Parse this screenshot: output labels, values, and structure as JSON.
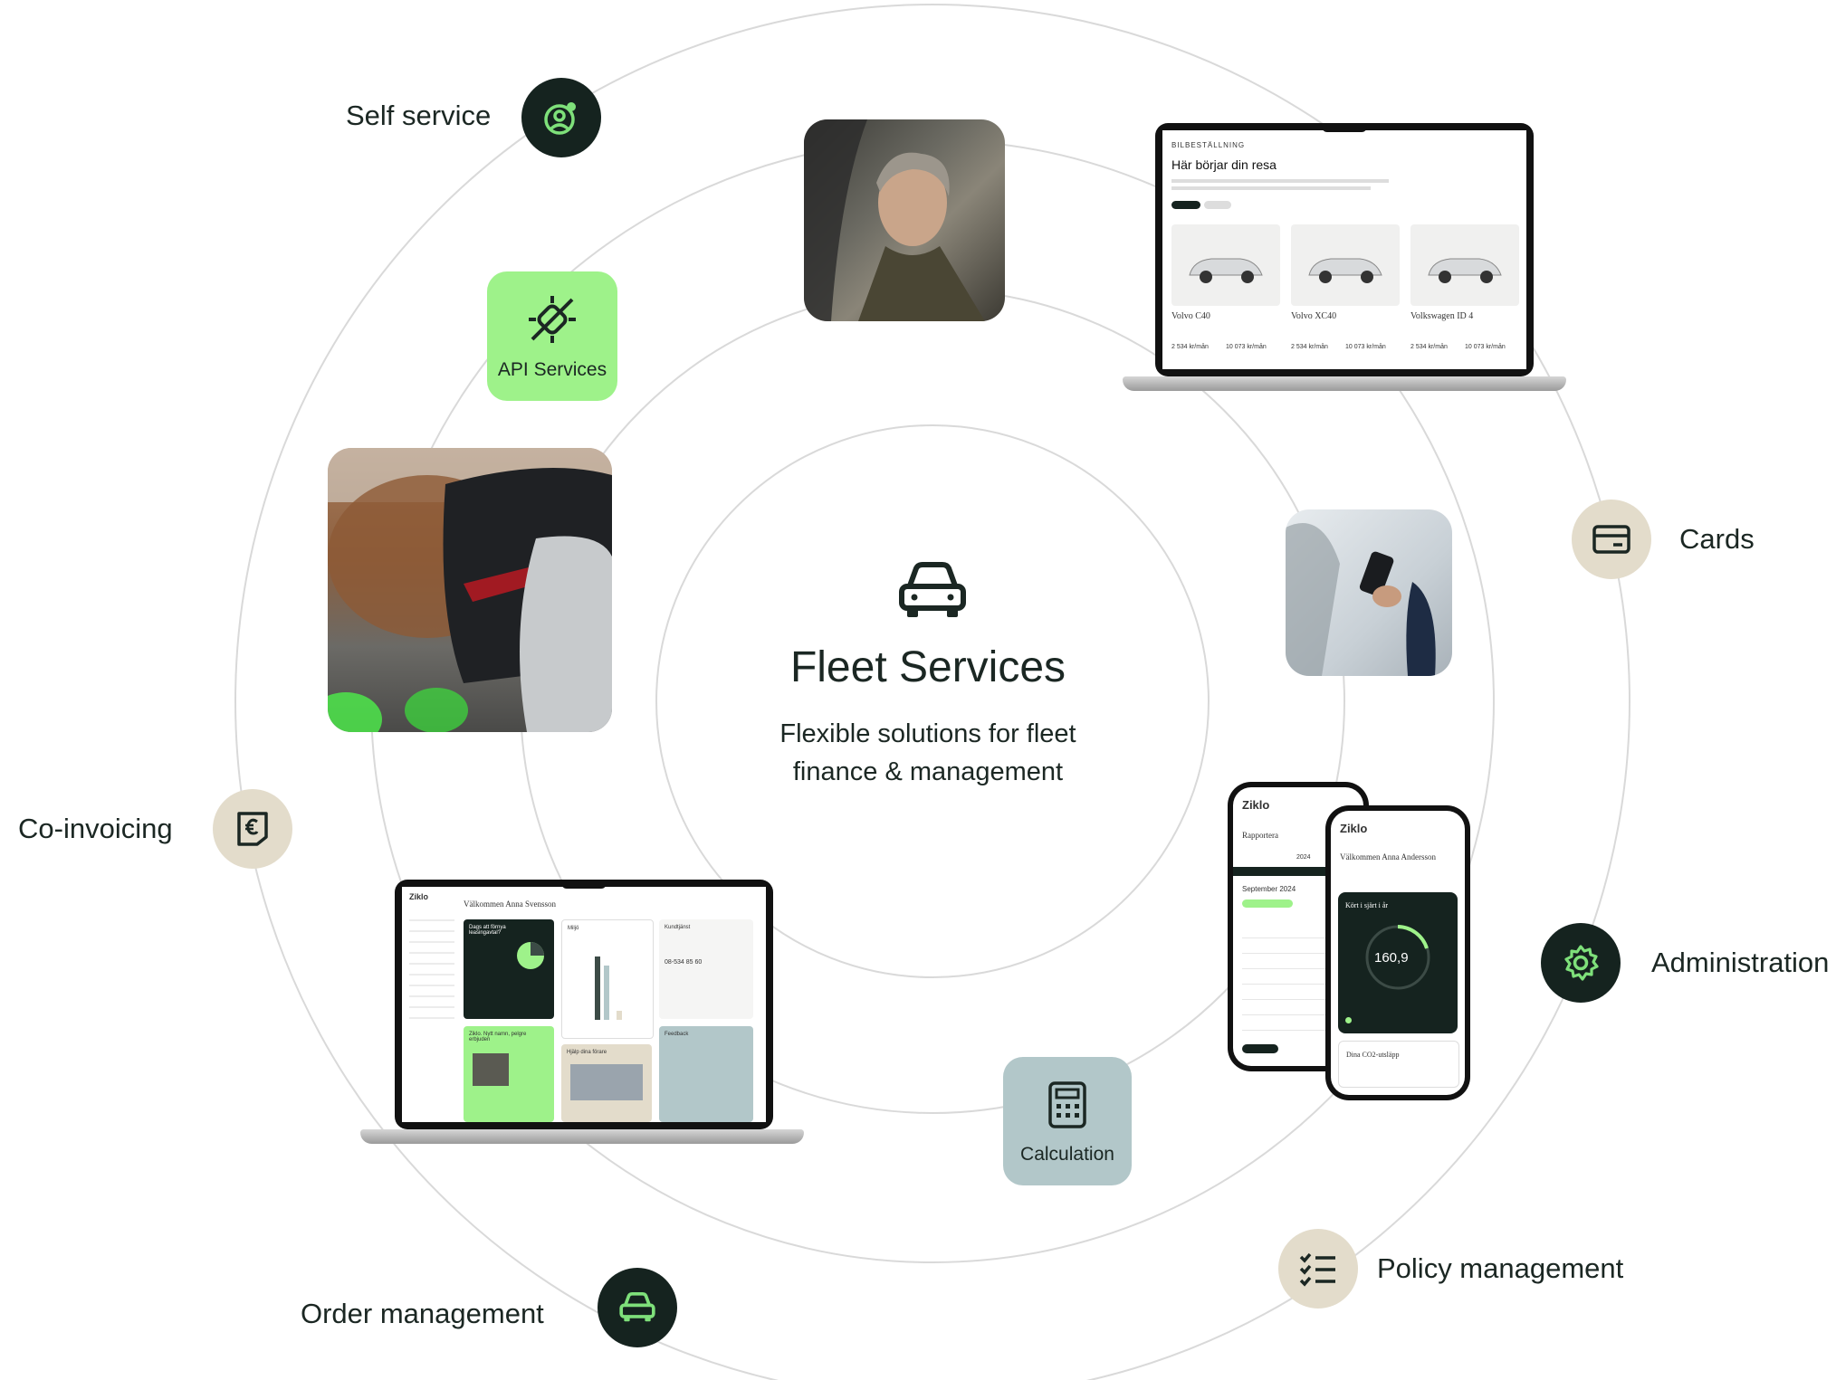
{
  "diagram": {
    "title": "Fleet Services",
    "subtitle_line1": "Flexible solutions for fleet",
    "subtitle_line2": "finance & management",
    "center_icon": "car-icon",
    "colors": {
      "dark": "#15231f",
      "beige": "#e3dccb",
      "green": "#9ef28a",
      "slate": "#b2c7c9",
      "ring": "#d9d9d9"
    }
  },
  "services": {
    "self_service": {
      "label": "Self service",
      "icon": "user-gear-icon"
    },
    "api_services": {
      "label": "API Services",
      "icon": "plug-disconnect-icon"
    },
    "cards": {
      "label": "Cards",
      "icon": "credit-card-icon"
    },
    "co_invoicing": {
      "label": "Co-invoicing",
      "icon": "euro-invoice-icon"
    },
    "administration": {
      "label": "Administration",
      "icon": "gear-icon"
    },
    "calculation": {
      "label": "Calculation",
      "icon": "calculator-icon"
    },
    "policy_management": {
      "label": "Policy management",
      "icon": "checklist-icon"
    },
    "order_management": {
      "label": "Order management",
      "icon": "car-icon"
    }
  },
  "laptop_top": {
    "kicker": "BILBESTÄLLNING",
    "heading": "Här börjar din resa",
    "cars": [
      {
        "name": "Volvo C40",
        "price": "2 534 kr/mån",
        "price2": "10 073 kr/mån"
      },
      {
        "name": "Volvo XC40",
        "price": "2 534 kr/mån",
        "price2": "10 073 kr/mån"
      },
      {
        "name": "Volkswagen ID 4",
        "price": "2 534 kr/mån",
        "price2": "10 073 kr/mån"
      }
    ]
  },
  "laptop_bottom": {
    "brand": "Ziklo",
    "welcome": "Välkommen Anna Svensson",
    "card_dark": "Dags att förnya leasingavtal?",
    "card_chart": "Miljö",
    "card_contact": "Kundtjänst",
    "phone_number": "08-534 85 60",
    "card_green": "Ziklo. Nytt namn, pelgre erbjuden",
    "card_beige": "Hjälp dina förare",
    "card_feedback": "Feedback"
  },
  "phones": {
    "brand": "Ziklo",
    "back_title": "Rapportera",
    "back_year": "2024",
    "back_month": "September 2024",
    "front_welcome": "Välkommen Anna Andersson",
    "front_card": "Kört i sjärt i år",
    "front_value": "160,9",
    "front_footer": "Dina CO2-utsläpp"
  }
}
